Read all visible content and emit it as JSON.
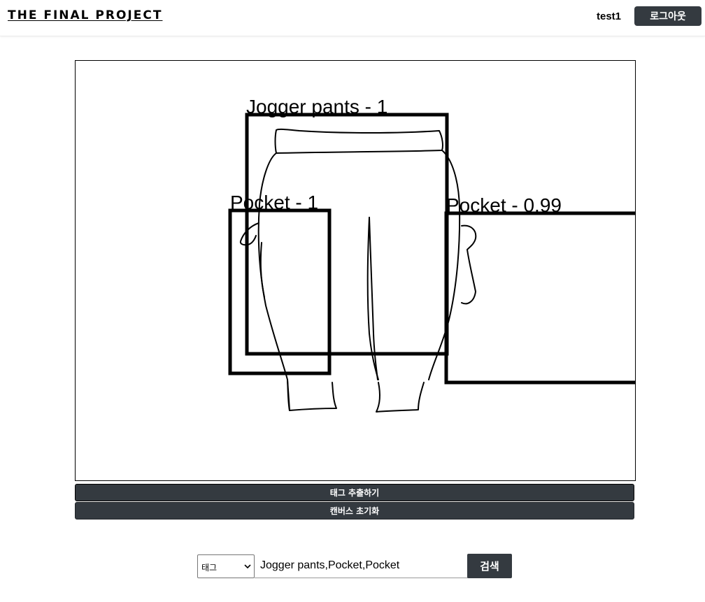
{
  "header": {
    "brand": "THE FINAL PROJECT",
    "username": "test1",
    "logout_label": "로그아웃"
  },
  "canvas": {
    "detections": [
      {
        "label": "Jogger pants - 1"
      },
      {
        "label": "Pocket - 1"
      },
      {
        "label": "Pocket - 0.99"
      }
    ]
  },
  "actions": {
    "extract_label": "태그 추출하기",
    "reset_label": "캔버스 초기화"
  },
  "search": {
    "select_value": "태그",
    "input_value": "Jogger pants,Pocket,Pocket",
    "button_label": "검색"
  },
  "colors": {
    "button_bg": "#343a40",
    "button_text": "#ffffff"
  }
}
